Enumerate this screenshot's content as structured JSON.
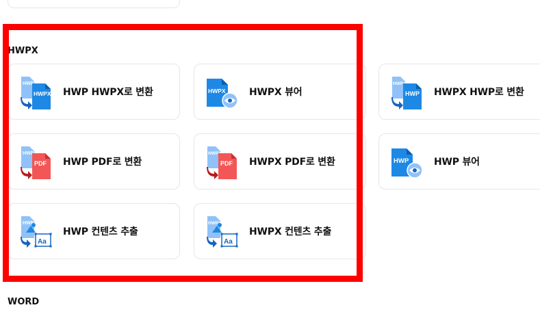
{
  "colors": {
    "highlight": "#ff0000",
    "doc_blue": "#1e88e5",
    "doc_light_blue": "#90c2f9",
    "pdf_red": "#f35656",
    "arrow_blue": "#1565c0",
    "arrow_red": "#b71c1c"
  },
  "sections": {
    "hwpx": {
      "title": "HWPX",
      "cards": [
        {
          "label": "HWP HWPX로 변환",
          "icon": "hwp-to-hwpx-icon",
          "back_text": "HWP",
          "front_text": "HWPX"
        },
        {
          "label": "HWPX 뷰어",
          "icon": "hwpx-viewer-icon",
          "front_text": "HWPX"
        },
        {
          "label": "HWPX HWP로 변환",
          "icon": "hwpx-to-hwp-icon",
          "back_text": "HWPX",
          "front_text": "HWP"
        },
        {
          "label": "HWP PDF로 변환",
          "icon": "hwp-to-pdf-icon",
          "back_text": "HWP",
          "front_text": "PDF"
        },
        {
          "label": "HWPX PDF로 변환",
          "icon": "hwpx-to-pdf-icon",
          "back_text": "HWPX",
          "front_text": "PDF"
        },
        {
          "label": "HWP 뷰어",
          "icon": "hwp-viewer-icon",
          "front_text": "HWP"
        },
        {
          "label": "HWP 컨텐츠 추출",
          "icon": "hwp-extract-icon",
          "back_text": "HWP",
          "front_text": "Aa"
        },
        {
          "label": "HWPX 컨텐츠 추출",
          "icon": "hwpx-extract-icon",
          "back_text": "HWPX",
          "front_text": "Aa"
        }
      ]
    },
    "word": {
      "title": "WORD"
    }
  }
}
